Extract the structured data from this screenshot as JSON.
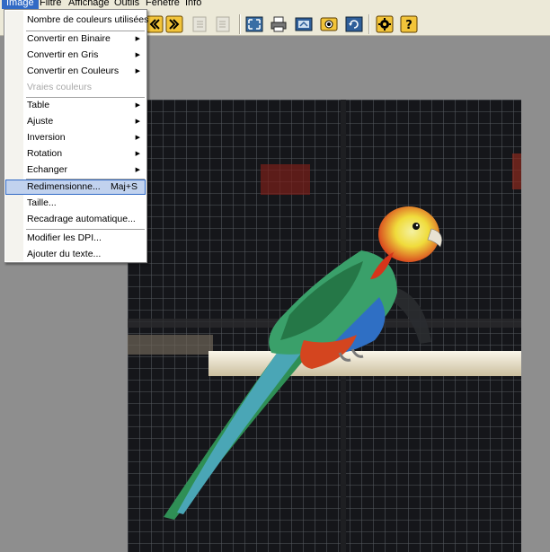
{
  "menubar": {
    "items": [
      "Image",
      "Filtre",
      "Affichage",
      "Outils",
      "Fenêtre",
      "Info"
    ],
    "active": "Image"
  },
  "toolbar": {
    "buttons": [
      "prev-icon",
      "next-icon",
      "page-left-icon",
      "page-right-icon",
      "fit-screen-icon",
      "print-icon",
      "scan-icon",
      "capture-icon",
      "refresh-icon",
      "settings-icon",
      "help-icon"
    ]
  },
  "image_menu": {
    "items": [
      {
        "label": "Nombre de couleurs utilisées"
      },
      {
        "label": "Convertir en Binaire"
      },
      {
        "label": "Convertir en Gris"
      },
      {
        "label": "Convertir en Couleurs"
      },
      {
        "label": "Vraies couleurs"
      },
      {
        "label": "Table"
      },
      {
        "label": "Ajuste"
      },
      {
        "label": "Inversion"
      },
      {
        "label": "Rotation"
      },
      {
        "label": "Echanger"
      },
      {
        "label": "Redimensionne...",
        "shortcut": "Maj+S"
      },
      {
        "label": "Taille..."
      },
      {
        "label": "Recadrage automatique..."
      },
      {
        "label": "Modifier les DPI..."
      },
      {
        "label": "Ajouter du texte..."
      }
    ]
  },
  "colors": {
    "menu_highlight": "#c1d2ee",
    "menu_highlight_border": "#316ac5",
    "workspace": "#8e8e8e",
    "chrome": "#ece9d8"
  }
}
